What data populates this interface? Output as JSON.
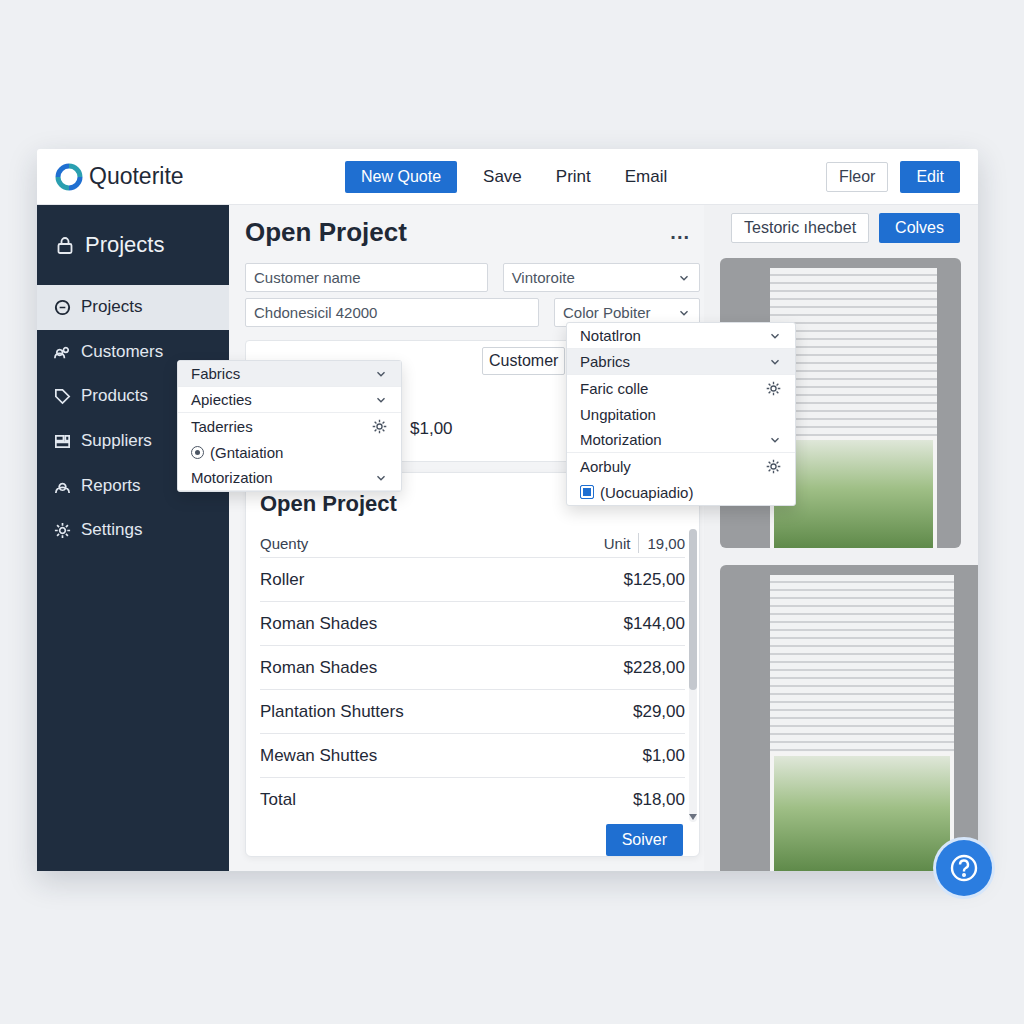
{
  "app": {
    "name": "Quoterite"
  },
  "toolbar": {
    "buttons": [
      {
        "label": "New Quote",
        "primary": true
      },
      {
        "label": "Save",
        "primary": false
      },
      {
        "label": "Print",
        "primary": false
      },
      {
        "label": "Email",
        "primary": false
      }
    ],
    "right_buttons": [
      {
        "label": "Fleor",
        "primary": false
      },
      {
        "label": "Edit",
        "primary": true
      }
    ]
  },
  "sidebar": {
    "title": "Projects",
    "items": [
      {
        "label": "Projects",
        "selected": true
      },
      {
        "label": "Customers",
        "selected": false
      },
      {
        "label": "Products",
        "selected": false
      },
      {
        "label": "Suppliers",
        "selected": false
      },
      {
        "label": "Reports",
        "selected": false
      },
      {
        "label": "Settings",
        "selected": false
      }
    ]
  },
  "main": {
    "title": "Open Project",
    "more": "...",
    "form_rows": [
      [
        {
          "kind": "input",
          "value": "Customer name"
        },
        {
          "kind": "select",
          "value": "Vintoroite"
        }
      ],
      [
        {
          "kind": "input",
          "value": "Chdonesicil 42000"
        },
        {
          "kind": "select",
          "value": "Color Pobiter"
        }
      ]
    ],
    "customer_button": "Customer",
    "amount": "$1,00"
  },
  "table": {
    "title": "Open Project",
    "columns": [
      "Quenty",
      "Unit",
      "19,00"
    ],
    "rows": [
      {
        "name": "Roller",
        "price": "$125,00"
      },
      {
        "name": "Roman Shades",
        "price": "$144,00"
      },
      {
        "name": "Roman Shades",
        "price": "$228,00"
      },
      {
        "name": "Plantation Shutters",
        "price": "$29,00"
      },
      {
        "name": "Mewan Shuttes",
        "price": "$1,00"
      }
    ],
    "total": {
      "label": "Total",
      "value": "$18,00"
    },
    "action": "Soiver",
    "scroll_level": 0.55
  },
  "right_panel": {
    "buttons": [
      {
        "label": "Testoric ıhecbet",
        "primary": false
      },
      {
        "label": "Colves",
        "primary": true
      }
    ]
  },
  "menus": [
    {
      "items": [
        {
          "label": "Fabrics",
          "kind": "submenu",
          "highlighted": true,
          "checked": false
        },
        {
          "label": "Apiecties",
          "kind": "submenu",
          "highlighted": false,
          "checked": false
        },
        {
          "label": "Taderries",
          "kind": "settings",
          "highlighted": false,
          "checked": false
        },
        {
          "label": "(Gntaiation",
          "kind": "radio",
          "highlighted": false,
          "checked": true
        },
        {
          "label": "Motorization",
          "kind": "submenu",
          "highlighted": false,
          "checked": false
        }
      ]
    },
    {
      "items": [
        {
          "label": "Notatlron",
          "kind": "submenu",
          "highlighted": false,
          "checked": false
        },
        {
          "label": "Pabrics",
          "kind": "submenu",
          "highlighted": true,
          "checked": false
        },
        {
          "label": "Faric colle",
          "kind": "settings",
          "highlighted": false,
          "checked": false
        },
        {
          "label": "Ungpitation",
          "kind": "plain",
          "highlighted": false,
          "checked": false
        },
        {
          "label": "Motorization",
          "kind": "submenu",
          "highlighted": false,
          "checked": false
        },
        {
          "label": "Aorbuly",
          "kind": "settings",
          "highlighted": false,
          "checked": false
        },
        {
          "label": "(Uocuapiadio)",
          "kind": "check",
          "highlighted": false,
          "checked": true
        }
      ]
    }
  ]
}
